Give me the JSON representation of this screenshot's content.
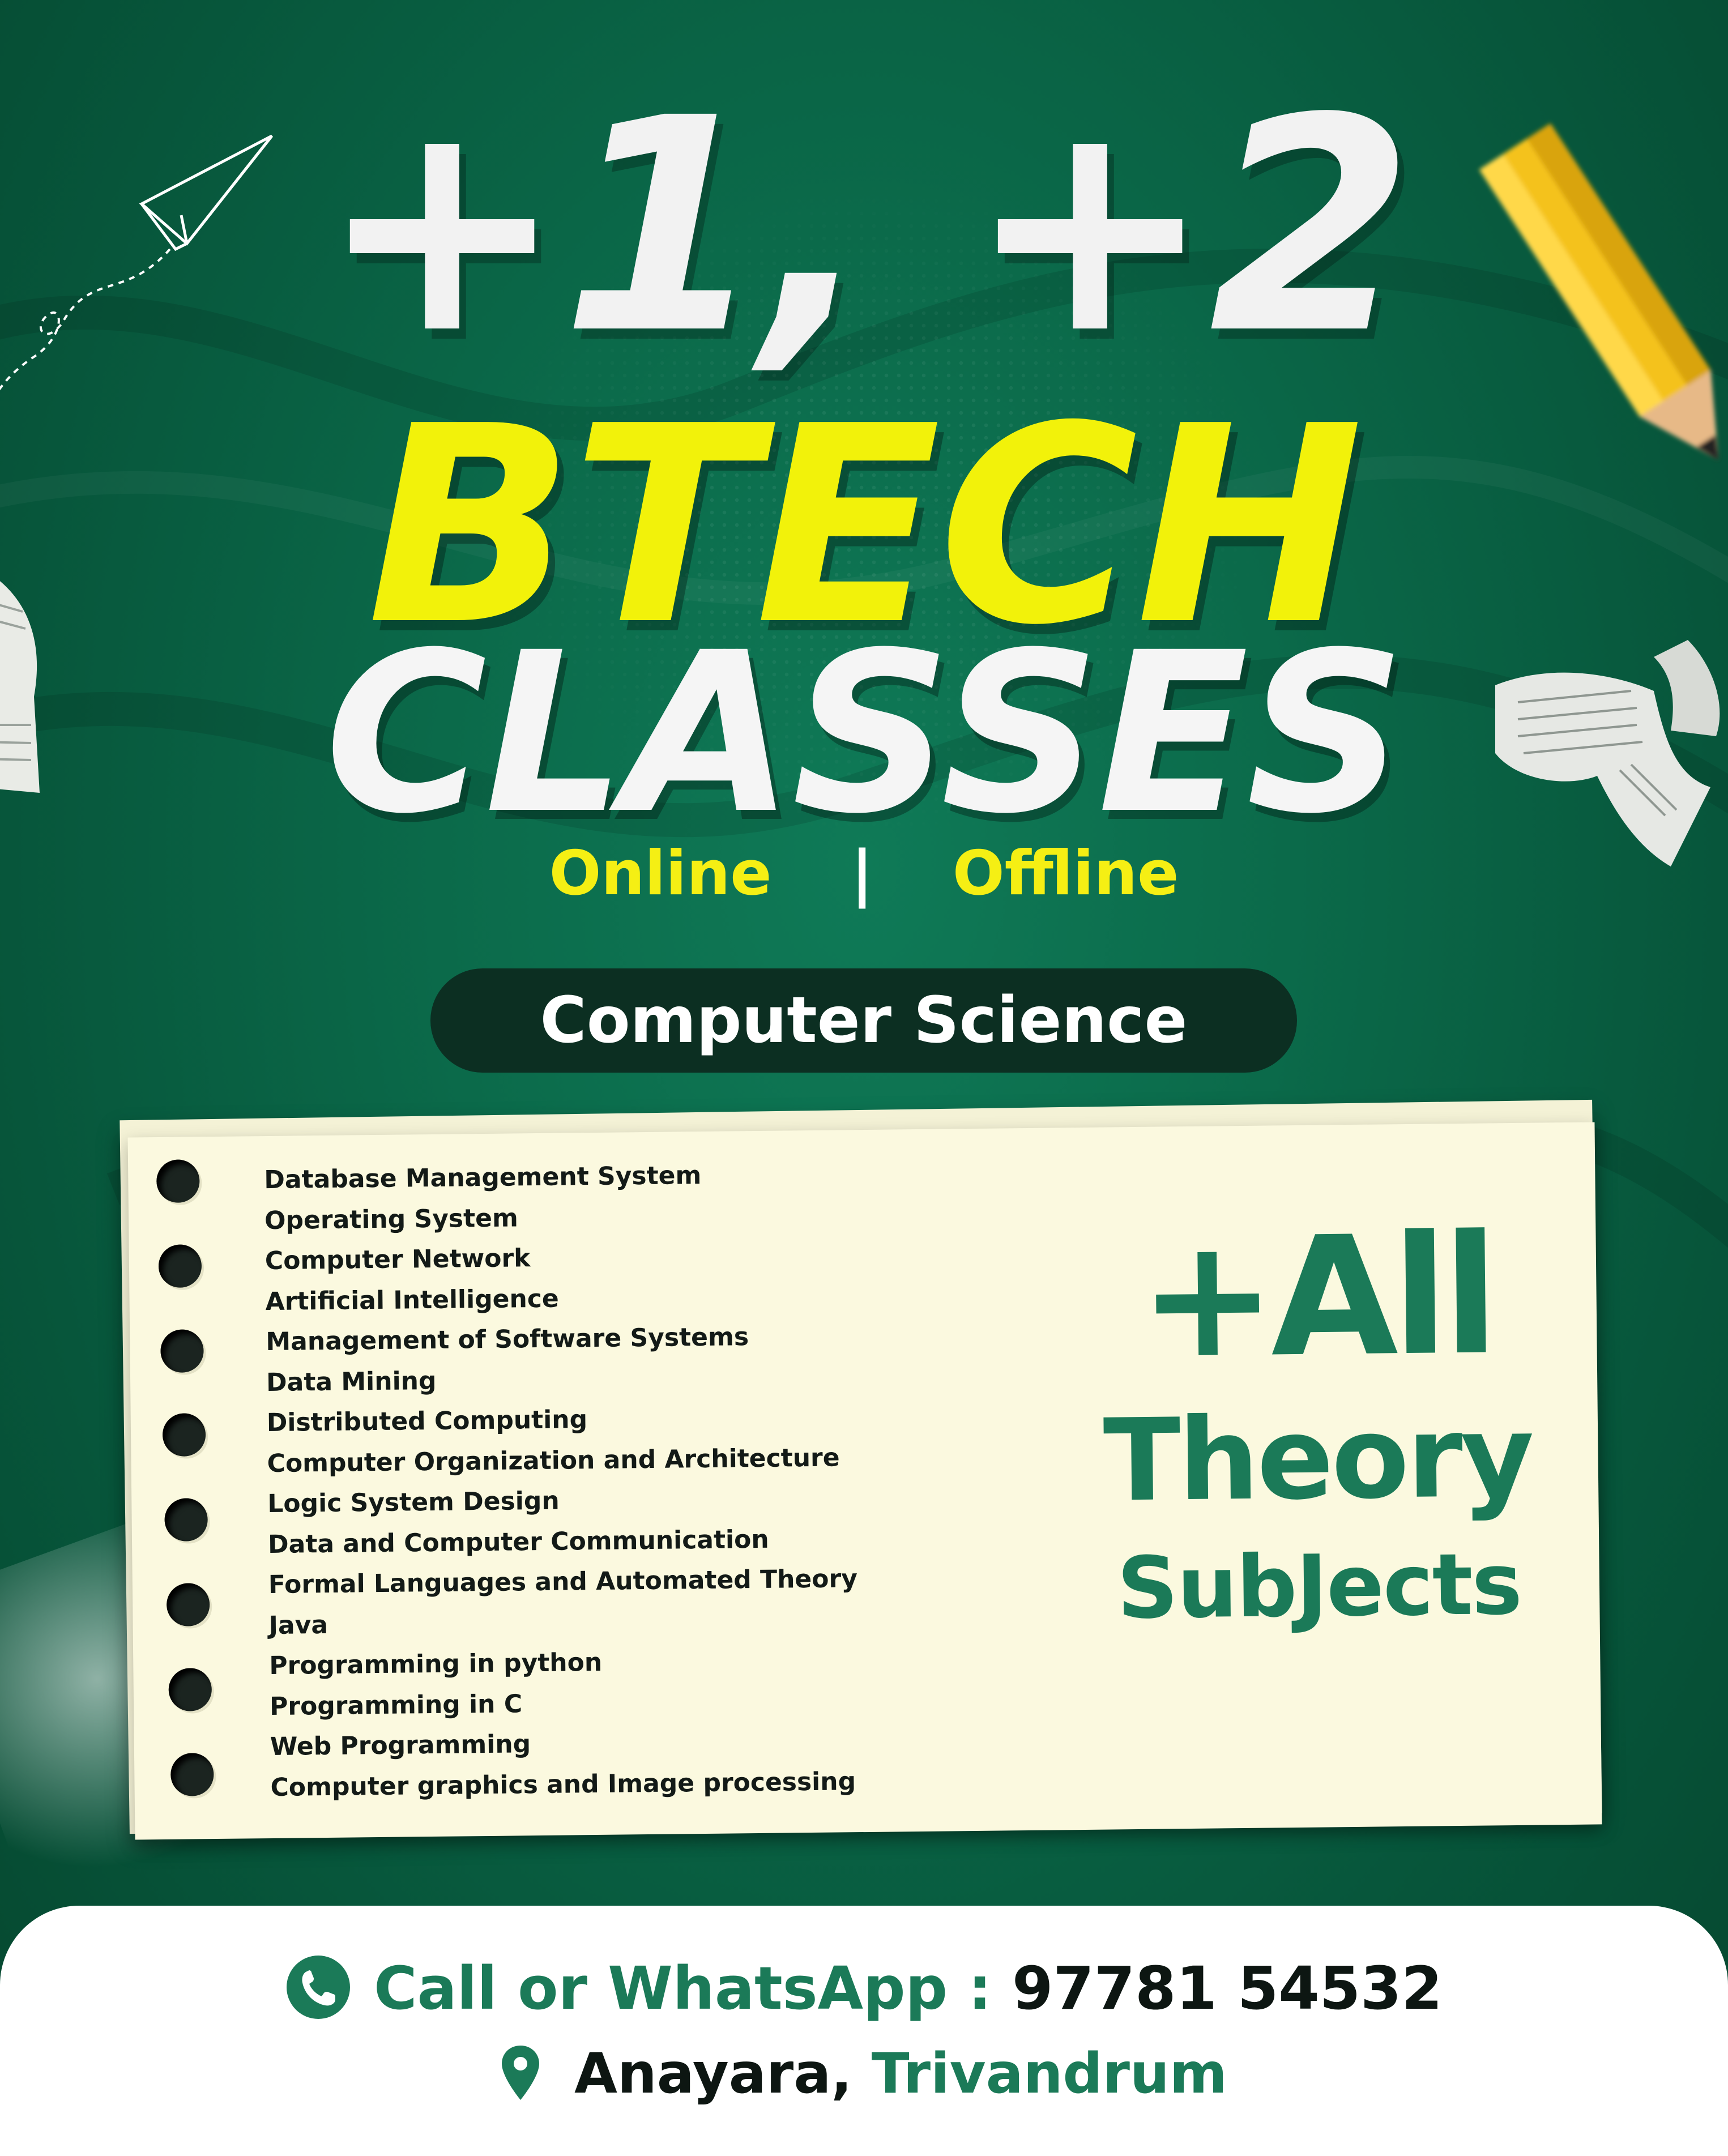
{
  "headline": {
    "line1": "+1, +2",
    "line2": "BTECH",
    "line3": "CLASSES"
  },
  "modes": {
    "online": "Online",
    "separator": "|",
    "offline": "Offline"
  },
  "department": "Computer Science",
  "subjects": [
    "Database Management System",
    "Operating System",
    "Computer Network",
    "Artificial Intelligence",
    "Management of Software Systems",
    "Data Mining",
    "Distributed Computing",
    "Computer Organization and Architecture",
    "Logic System Design",
    "Data and Computer Communication",
    "Formal Languages and Automated Theory",
    "Java",
    "Programming in python",
    "Programming in C",
    "Web Programming",
    "Computer graphics and Image processing"
  ],
  "extra": {
    "line1": "+All",
    "line2": "Theory",
    "line3": "SubJects"
  },
  "contact": {
    "label": "Call or WhatsApp :",
    "phone": "97781 54532",
    "town": "Anayara,",
    "city": "Trivandrum"
  },
  "icons": {
    "phone": "whatsapp-phone-icon",
    "location": "location-pin-icon",
    "paper_plane": "paper-plane-icon",
    "pencil": "pencil-icon"
  },
  "colors": {
    "background": "#0b6a4a",
    "accent_yellow": "#f2f20a",
    "accent_green": "#1b7a58",
    "pill": "#0c2f22",
    "note_paper": "#fbf9df"
  }
}
